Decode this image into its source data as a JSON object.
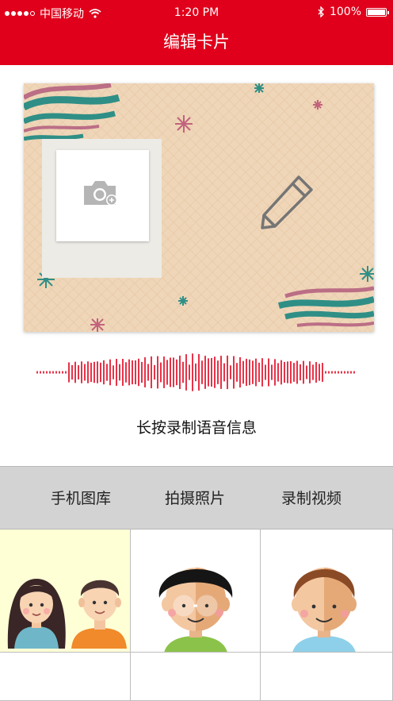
{
  "status": {
    "carrier": "中国移动",
    "time": "1:20 PM",
    "battery": "100%"
  },
  "nav": {
    "title": "编辑卡片"
  },
  "card": {
    "photo_icon": "camera-add-icon",
    "edit_icon": "pencil-icon"
  },
  "voice": {
    "hint": "长按录制语音信息",
    "wave_icon": "sound-wave-icon"
  },
  "tabs": [
    {
      "label": "手机图库"
    },
    {
      "label": "拍摄照片"
    },
    {
      "label": "录制视频"
    }
  ],
  "gallery": {
    "items": [
      {
        "name": "couple-avatar"
      },
      {
        "name": "boy-glasses-avatar"
      },
      {
        "name": "boy-avatar"
      }
    ]
  },
  "colors": {
    "accent": "#e0001b",
    "card_bg": "#efd6b8",
    "teal": "#2f8f86",
    "mauve": "#b25c7c"
  }
}
